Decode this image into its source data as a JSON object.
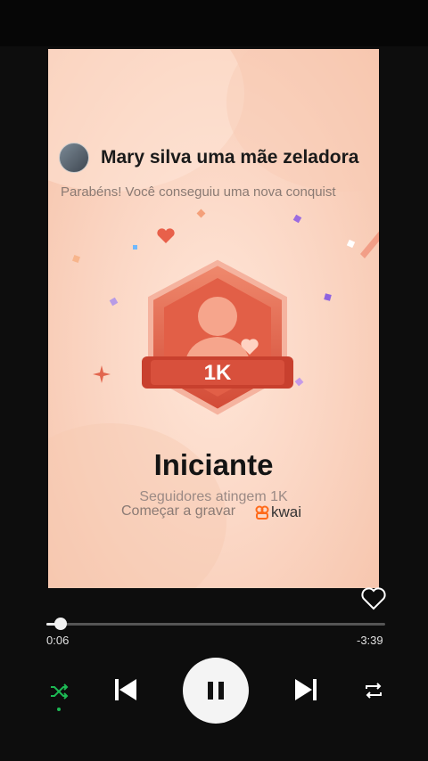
{
  "card": {
    "username": "Mary silva uma mãe zeladora",
    "subtitle": "Parabéns! Você conseguiu uma nova conquist",
    "badge_text": "1K",
    "title": "Iniciante",
    "description": "Seguidores atingem 1K",
    "record_label": "Começar a gravar",
    "brand": "kwai"
  },
  "player": {
    "elapsed": "0:06",
    "remaining": "-3:39",
    "progress_fraction": 0.04
  },
  "colors": {
    "badge": "#d8503c",
    "shuffle_active": "#1db954"
  },
  "icons": [
    "heart-icon",
    "shuffle-icon",
    "previous-icon",
    "pause-icon",
    "next-icon",
    "repeat-icon"
  ]
}
